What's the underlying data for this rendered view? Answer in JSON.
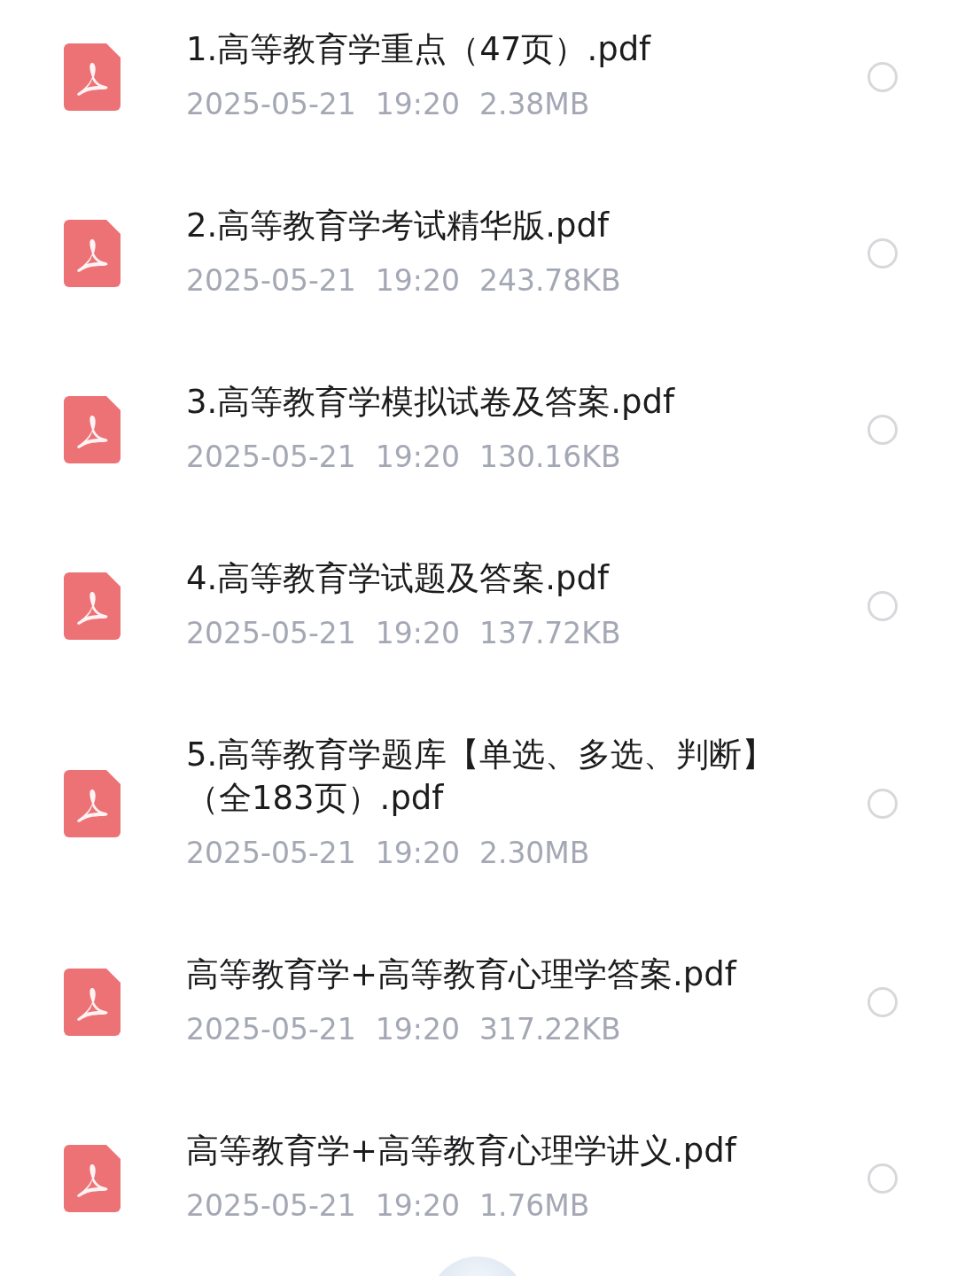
{
  "files": [
    {
      "title": "1.高等教育学重点（47页）.pdf",
      "date": "2025-05-21",
      "time": "19:20",
      "size": "2.38MB",
      "selected": false
    },
    {
      "title": "2.高等教育学考试精华版.pdf",
      "date": "2025-05-21",
      "time": "19:20",
      "size": "243.78KB",
      "selected": false
    },
    {
      "title": "3.高等教育学模拟试卷及答案.pdf",
      "date": "2025-05-21",
      "time": "19:20",
      "size": "130.16KB",
      "selected": false
    },
    {
      "title": "4.高等教育学试题及答案.pdf",
      "date": "2025-05-21",
      "time": "19:20",
      "size": "137.72KB",
      "selected": false
    },
    {
      "title": "5.高等教育学题库【单选、多选、判断】（全183页）.pdf",
      "date": "2025-05-21",
      "time": "19:20",
      "size": "2.30MB",
      "selected": false
    },
    {
      "title": "高等教育学+高等教育心理学答案.pdf",
      "date": "2025-05-21",
      "time": "19:20",
      "size": "317.22KB",
      "selected": false
    },
    {
      "title": "高等教育学+高等教育心理学讲义.pdf",
      "date": "2025-05-21",
      "time": "19:20",
      "size": "1.76MB",
      "selected": false
    }
  ]
}
